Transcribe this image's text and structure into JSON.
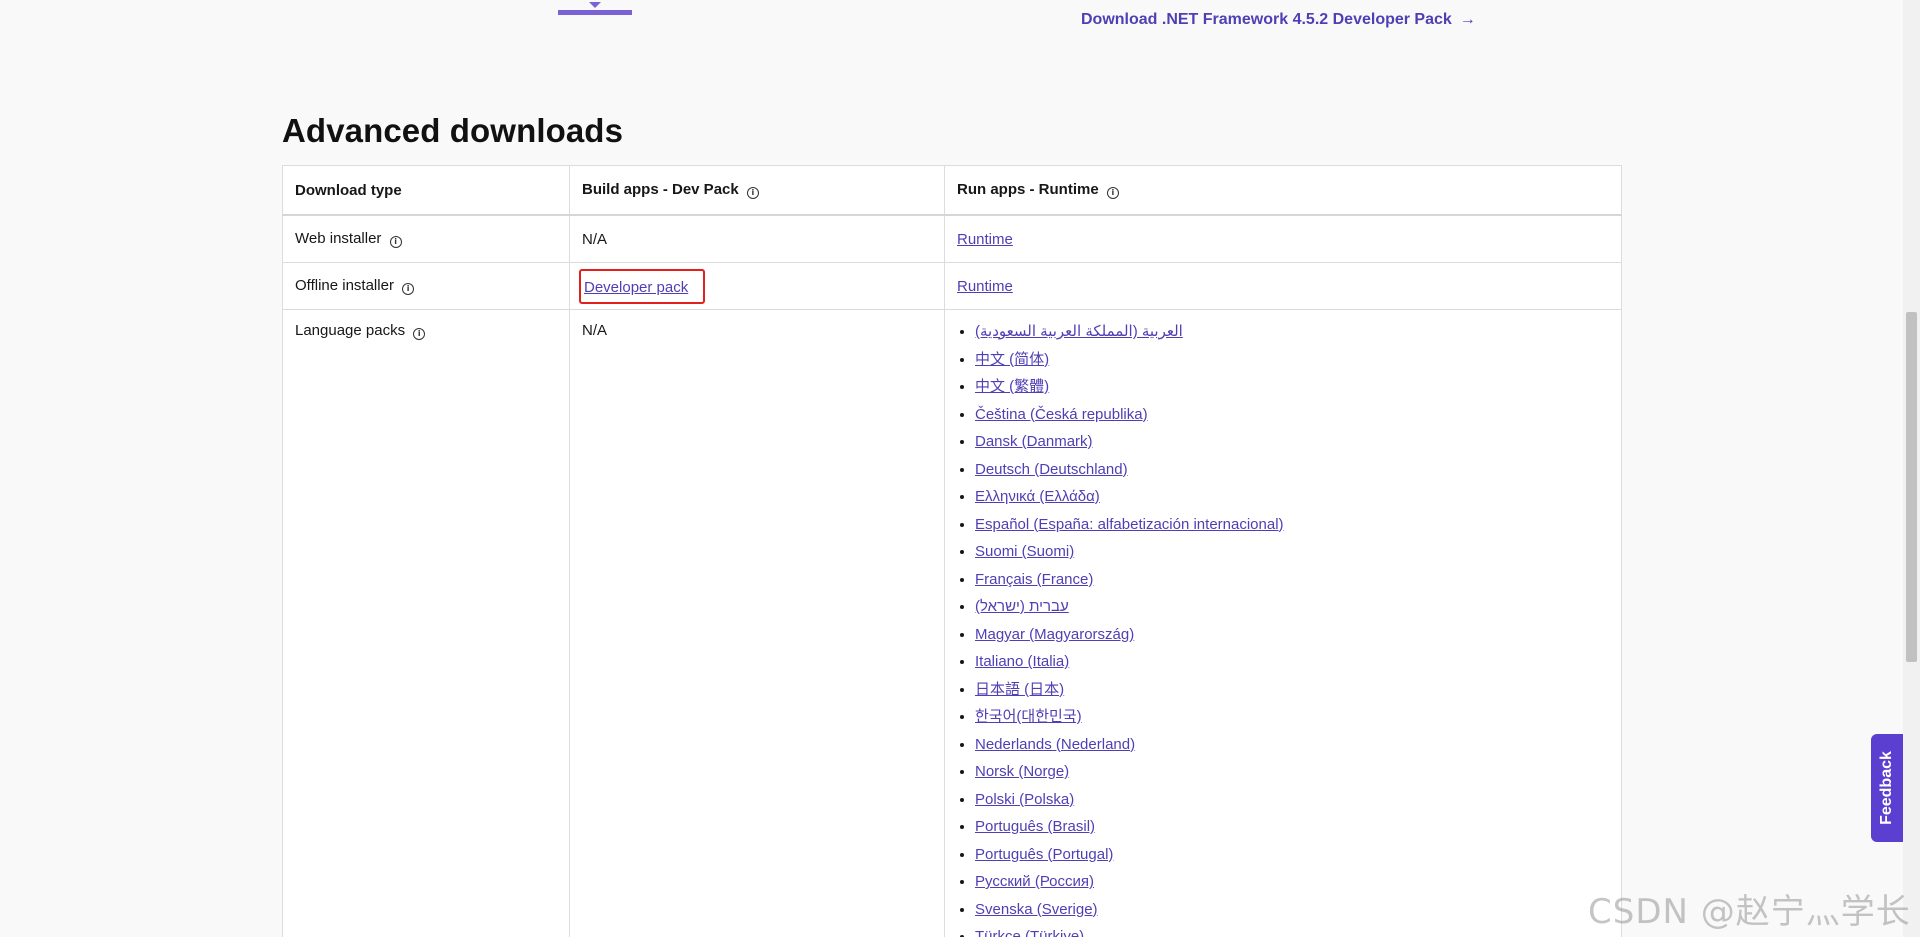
{
  "top": {
    "download_link_label": "Download .NET Framework 4.5.2 Developer Pack",
    "arrow_icon": "arrow-right-icon"
  },
  "section": {
    "heading": "Advanced downloads"
  },
  "table": {
    "headers": {
      "download_type": "Download type",
      "build_apps": "Build apps - Dev Pack",
      "run_apps": "Run apps - Runtime"
    },
    "rows": {
      "web_installer": {
        "label": "Web installer",
        "dev_pack": "N/A",
        "runtime": "Runtime"
      },
      "offline_installer": {
        "label": "Offline installer",
        "dev_pack": "Developer pack",
        "runtime": "Runtime"
      },
      "language_packs": {
        "label": "Language packs",
        "dev_pack": "N/A",
        "languages": [
          "العربية (المملكة العربية السعودية)",
          "中文 (简体)",
          "中文 (繁體)",
          "Čeština (Česká republika)",
          "Dansk (Danmark)",
          "Deutsch (Deutschland)",
          "Ελληνικά (Ελλάδα)",
          "Español (España: alfabetización internacional)",
          "Suomi (Suomi)",
          "Français (France)",
          "עברית (ישראל)",
          "Magyar (Magyarország)",
          "Italiano (Italia)",
          "日本語 (日本)",
          "한국어(대한민국)",
          "Nederlands (Nederland)",
          "Norsk (Norge)",
          "Polski (Polska)",
          "Português (Brasil)",
          "Português (Portugal)",
          "Русский (Россия)",
          "Svenska (Sverige)",
          "Türkçe (Türkiye)"
        ]
      }
    }
  },
  "feedback": {
    "label": "Feedback"
  },
  "watermark": {
    "text": "CSDN @赵宁灬学长"
  },
  "colors": {
    "accent": "#4f3fb4",
    "tab_indicator": "#7b61d8",
    "feedback_bg": "#5b3fd0",
    "highlight_border": "#e3201b"
  }
}
